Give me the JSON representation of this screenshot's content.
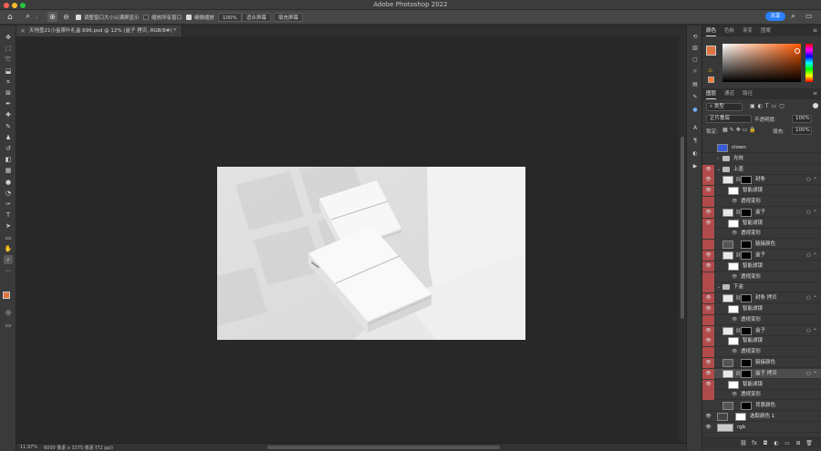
{
  "window": {
    "title": "Adobe Photoshop 2022",
    "traffic_colors": [
      "#ff5f57",
      "#febc2e",
      "#28c840"
    ]
  },
  "options_bar": {
    "resize_windows_label": "调整窗口大小以满屏显示",
    "zoom_all_windows_label": "缩放所有窗口",
    "scrubby_zoom_label": "细微缩放",
    "zoom_percent": "100%",
    "fit_screen_label": "适合屏幕",
    "fill_screen_label": "填充屏幕",
    "share_label": "共享",
    "share_color": "#2a7fff"
  },
  "document": {
    "tab_title": "天地盖21小盒茶叶礼盒.696.psd @ 12% (盒子 拷贝, RGB/8#) *",
    "canvas_bg": "#e6e6e6"
  },
  "status": {
    "zoom": "11.97%",
    "dimensions": "6000 像素 x 3375 像素 (72 ppi)"
  },
  "tools": [
    "move-icon",
    "marquee-icon",
    "lasso-icon",
    "object-select-icon",
    "crop-icon",
    "frame-icon",
    "eyedropper-icon",
    "healing-icon",
    "brush-icon",
    "stamp-icon",
    "history-brush-icon",
    "eraser-icon",
    "gradient-icon",
    "blur-icon",
    "dodge-icon",
    "pen-icon",
    "type-icon",
    "path-select-icon",
    "rectangle-icon",
    "hand-icon",
    "zoom-icon",
    "more-tools-icon"
  ],
  "colors": {
    "foreground": "#e07440",
    "background": "#ffffff"
  },
  "color_panel": {
    "tabs": [
      "颜色",
      "色板",
      "渐变",
      "图案"
    ],
    "active_tab": 0
  },
  "layers_panel": {
    "tabs": [
      "图层",
      "通道",
      "路径"
    ],
    "active_tab": 0,
    "filter_type": "类型",
    "blend_mode": "正片叠底",
    "opacity_label": "不透明度:",
    "opacity": "100%",
    "lock_label": "锁定:",
    "fill_label": "填充:",
    "fill": "100%",
    "highlight_color": "#b14a4a",
    "layers": [
      {
        "name": "clown",
        "kind": "image",
        "indent": 0,
        "red": false,
        "eye": false
      },
      {
        "name": "光效",
        "kind": "group",
        "indent": 0,
        "red": false,
        "eye": false
      },
      {
        "name": "上盖",
        "kind": "group-open",
        "indent": 0,
        "red": true,
        "eye": true
      },
      {
        "name": "封条",
        "kind": "smart",
        "indent": 1,
        "red": true,
        "eye": true,
        "fx": true
      },
      {
        "name": "智能滤镜",
        "kind": "filter",
        "indent": 2,
        "red": true,
        "eye": true
      },
      {
        "name": "透视变形",
        "kind": "filter-item",
        "indent": 3,
        "red": true,
        "eye": false
      },
      {
        "name": "盒子",
        "kind": "smart",
        "indent": 1,
        "red": true,
        "eye": true,
        "fx": true
      },
      {
        "name": "智能滤镜",
        "kind": "filter",
        "indent": 2,
        "red": true,
        "eye": true
      },
      {
        "name": "透视变形",
        "kind": "filter-item",
        "indent": 3,
        "red": true,
        "eye": false
      },
      {
        "name": "链接颜色",
        "kind": "adjust",
        "indent": 1,
        "red": true,
        "eye": false
      },
      {
        "name": "盒子",
        "kind": "smart",
        "indent": 1,
        "red": true,
        "eye": true,
        "fx": true
      },
      {
        "name": "智能滤镜",
        "kind": "filter",
        "indent": 2,
        "red": true,
        "eye": true
      },
      {
        "name": "透视变形",
        "kind": "filter-item",
        "indent": 3,
        "red": true,
        "eye": false
      },
      {
        "name": "下盒",
        "kind": "group-open",
        "indent": 0,
        "red": true,
        "eye": false
      },
      {
        "name": "封条 拷贝",
        "kind": "smart",
        "indent": 1,
        "red": true,
        "eye": true,
        "fx": true
      },
      {
        "name": "智能滤镜",
        "kind": "filter",
        "indent": 2,
        "red": true,
        "eye": true
      },
      {
        "name": "透视变形",
        "kind": "filter-item",
        "indent": 3,
        "red": true,
        "eye": false
      },
      {
        "name": "盒子",
        "kind": "smart",
        "indent": 1,
        "red": true,
        "eye": true,
        "fx": true
      },
      {
        "name": "智能滤镜",
        "kind": "filter",
        "indent": 2,
        "red": true,
        "eye": true
      },
      {
        "name": "透视变形",
        "kind": "filter-item",
        "indent": 3,
        "red": true,
        "eye": false
      },
      {
        "name": "链接颜色",
        "kind": "adjust",
        "indent": 1,
        "red": true,
        "eye": true
      },
      {
        "name": "盒子 拷贝",
        "kind": "smart",
        "indent": 1,
        "red": true,
        "eye": true,
        "fx": true,
        "selected": true
      },
      {
        "name": "智能滤镜",
        "kind": "filter",
        "indent": 2,
        "red": true,
        "eye": true
      },
      {
        "name": "透视变形",
        "kind": "filter-item",
        "indent": 3,
        "red": true,
        "eye": false
      },
      {
        "name": "背景颜色",
        "kind": "adjust",
        "indent": 1,
        "red": false,
        "eye": false
      },
      {
        "name": "选取颜色 1",
        "kind": "adjust2",
        "indent": 0,
        "red": false,
        "eye": true
      },
      {
        "name": "rgb",
        "kind": "image2",
        "indent": 0,
        "red": false,
        "eye": true
      }
    ],
    "footer_icons": [
      "link-icon",
      "fx-icon",
      "mask-icon",
      "adjustment-icon",
      "folder-icon",
      "new-layer-icon",
      "trash-icon"
    ]
  }
}
